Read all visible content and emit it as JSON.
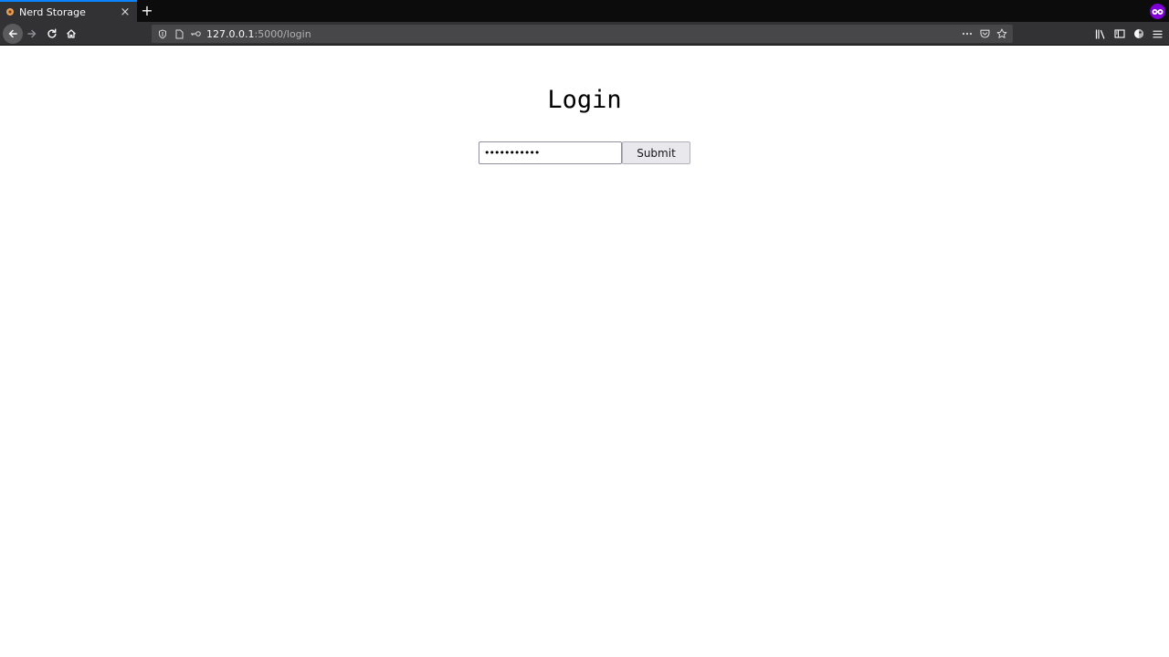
{
  "browser": {
    "tab_title": "Nerd Storage",
    "tab_close": "×",
    "new_tab": "+",
    "url_host": "127.0.0.1",
    "url_path": ":5000/login",
    "colors": {
      "tabstrip": "#0c0c0d",
      "toolbar": "#323234",
      "urlbar": "#474749",
      "private_badge": "#8000d7"
    }
  },
  "page": {
    "title": "Login",
    "password": {
      "value": "•••••••••••",
      "type": "password"
    },
    "submit_label": "Submit"
  }
}
